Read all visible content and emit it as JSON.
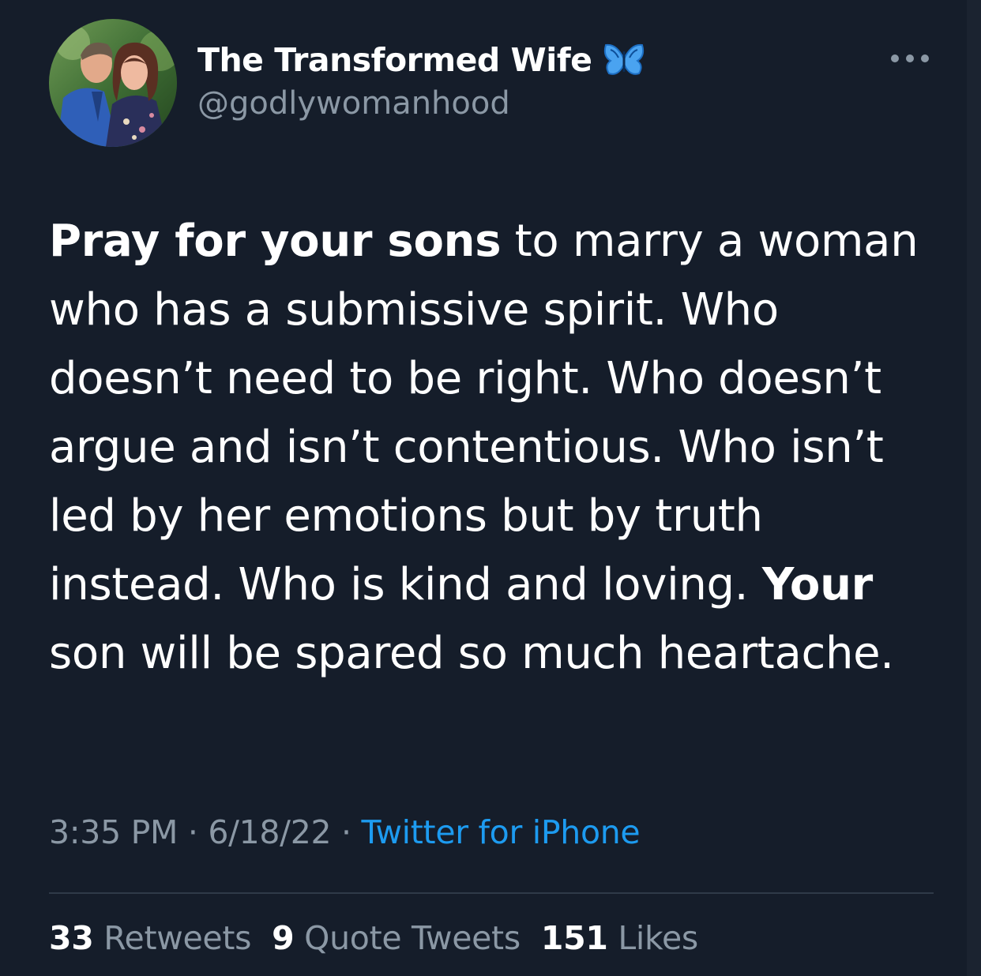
{
  "author": {
    "display_name": "The Transformed Wife",
    "handle": "@godlywomanhood",
    "badge_icon": "butterfly-emoji-icon",
    "avatar": "profile-photo-couple"
  },
  "tweet": {
    "segments": [
      {
        "text": "Pray for your sons",
        "bold": true
      },
      {
        "text": " to marry a woman who has a submissive spirit. Who doesn’t need to be right. Who doesn’t argue and isn’t contentious. Who isn’t led by her emotions but by truth instead. Who is kind and loving. ",
        "bold": false
      },
      {
        "text": "Your",
        "bold": true
      },
      {
        "text": " son will be spared so much heartache.",
        "bold": false
      }
    ],
    "time": "3:35 PM",
    "date": "6/18/22",
    "separator": "·",
    "source": "Twitter for iPhone"
  },
  "stats": {
    "retweets_count": "33",
    "retweets_label": "Retweets",
    "quotes_count": "9",
    "quotes_label": "Quote Tweets",
    "likes_count": "151",
    "likes_label": "Likes"
  },
  "colors": {
    "background": "#151d2a",
    "text": "#ffffff",
    "secondary": "#8b98a5",
    "link": "#1d9bf0"
  }
}
